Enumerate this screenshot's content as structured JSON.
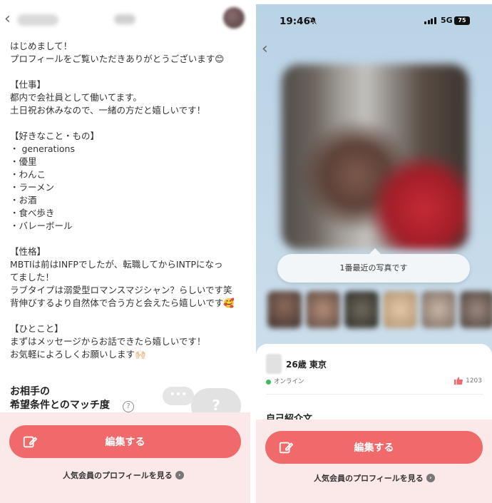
{
  "left": {
    "bio_lines": [
      "はじめまして！",
      "プロフィールをご覧いただきありがとうございます😊",
      "",
      "【仕事】",
      "都内で会社員として働いてます。",
      "土日祝お休みなので、一緒の方だと嬉しいです！",
      "",
      "【好きなこと・もの】",
      "・ generations",
      "・優里",
      "・わんこ",
      "・ラーメン",
      "・お酒",
      "・食べ歩き",
      "・バレーボール",
      "",
      "【性格】",
      "MBTIは前はINFPでしたが、転職してからINTPになっ",
      "てました！",
      "ラブタイプは溺愛型ロマンスマジシャン？らしいです笑",
      "背伸びするより自然体で合う方と会えたら嬉しいです🥰",
      "",
      "【ひとこと】",
      "まずはメッセージからお話できたら嬉しいです！",
      "お気軽によろしくお願いします🙌🏻"
    ],
    "match_title_line1": "お相手の",
    "match_title_line2": "希望条件とのマッチ度",
    "help_glyph": "?",
    "bubble_dots": "•••",
    "bubble_q": "?"
  },
  "right": {
    "status": {
      "time": "19:46",
      "network": "5G",
      "battery": "75"
    },
    "photo_tooltip": "1番最近の写真です",
    "age_location": "26歳 東京",
    "online_status": "オンライン",
    "like_count": "1203",
    "section_peek": "自己紹介文"
  },
  "common": {
    "edit_button": "編集する",
    "popular_link": "人気会員のプロフィールを見る",
    "back_glyph": "‹",
    "chevron_glyph": "›"
  },
  "colors": {
    "accent": "#f0696b",
    "footer_bg": "#fbe8e8",
    "online": "#3dbb5d"
  }
}
